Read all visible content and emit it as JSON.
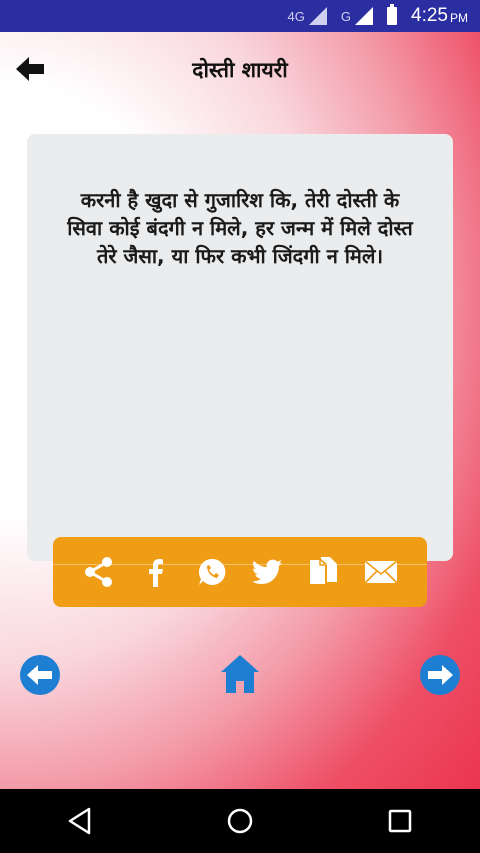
{
  "status_bar": {
    "network_4g": "4G",
    "network_g": "G",
    "time": "4:25",
    "ampm": "PM"
  },
  "app_bar": {
    "title": "दोस्ती शायरी"
  },
  "quote": {
    "text": "करनी है खुदा से गुजारिश कि, तेरी दोस्ती के सिवा कोई बंदगी न मिले, हर जन्म में मिले दोस्त तेरे जैसा, या फिर कभी जिंदगी न मिले।"
  },
  "share_bar": {
    "icons": [
      "share-icon",
      "facebook-icon",
      "whatsapp-icon",
      "twitter-icon",
      "copy-icon",
      "email-icon"
    ]
  },
  "navigation": {
    "prev": "arrow-left-circle-icon",
    "home": "home-icon",
    "next": "arrow-right-circle-icon"
  },
  "colors": {
    "status_bar": "#2b2ea0",
    "share_bar": "#ee9d15",
    "nav_blue": "#1e7fd2",
    "card": "#eaecee"
  }
}
